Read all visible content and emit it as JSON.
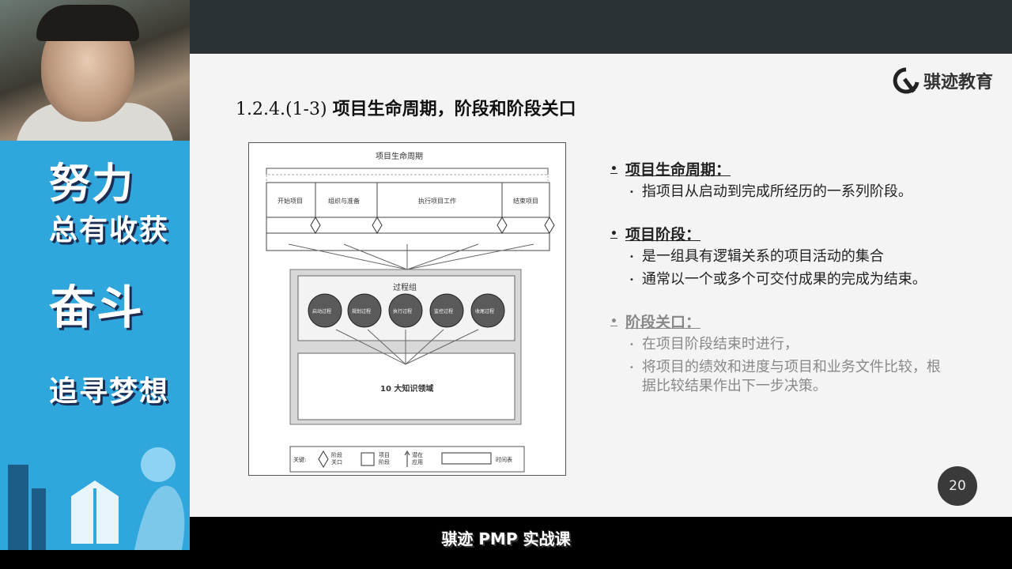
{
  "banner": {
    "line1": "努力",
    "line2": "总有收获",
    "line3": "奋斗",
    "line4": "追寻梦想"
  },
  "slide": {
    "title_num": "1.2.4.(1-3)",
    "title_text": "项目生命周期，阶段和阶段关口",
    "logo_text": "骐迹教育",
    "page_number": "20"
  },
  "diagram": {
    "top_label": "项目生命周期",
    "phases": [
      "开始项目",
      "组织与准备",
      "执行项目工作",
      "结束项目"
    ],
    "process_group_label": "过程组",
    "processes": [
      "启动过程",
      "规划过程",
      "执行过程",
      "监控过程",
      "收尾过程"
    ],
    "knowledge_areas": "10 大知识领域",
    "legend": {
      "key": "关键:",
      "gate": "阶段关口",
      "phase": "项目阶段",
      "potential": "潜在应用",
      "timeline": "时间表"
    }
  },
  "bullets": [
    {
      "heading": "项目生命周期：",
      "items": [
        "指项目从启动到完成所经历的一系列阶段。"
      ]
    },
    {
      "heading": "项目阶段：",
      "items": [
        "是一组具有逻辑关系的项目活动的集合",
        "通常以一个或多个可交付成果的完成为结束。"
      ]
    },
    {
      "heading": "阶段关口：",
      "items": [
        "在项目阶段结束时进行，",
        "将项目的绩效和进度与项目和业务文件比较，根据比较结果作出下一步决策。"
      ]
    }
  ],
  "caption": "骐迹 PMP 实战课",
  "colors": {
    "banner": "#2fa6dc",
    "slide_bg": "#f4f4f4",
    "topbar": "#2a3236"
  }
}
